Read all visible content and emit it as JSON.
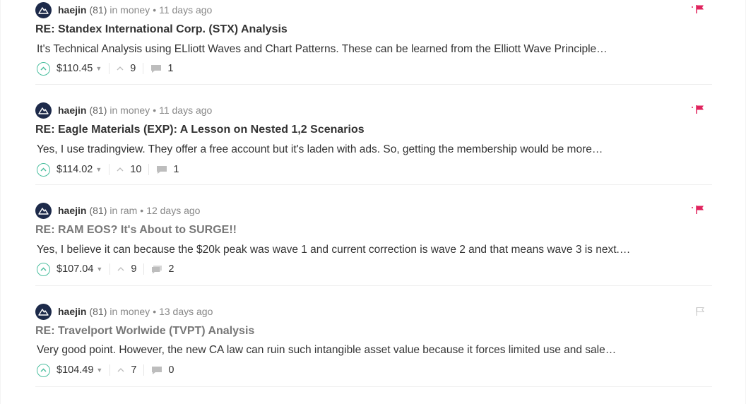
{
  "posts": [
    {
      "author": "haejin",
      "reputation": "(81)",
      "community_prefix": "in money",
      "separator": "•",
      "age": "11 days ago",
      "title": "RE: Standex International Corp. (STX) Analysis",
      "title_style": "dark",
      "body": "It's Technical Analysis using ELliott Waves and Chart Patterns. These can be learned from the Elliott Wave Principle…",
      "payout": "$110.45",
      "votes": "9",
      "replies": "1",
      "flagged": true
    },
    {
      "author": "haejin",
      "reputation": "(81)",
      "community_prefix": "in money",
      "separator": "•",
      "age": "11 days ago",
      "title": "RE: Eagle Materials (EXP): A Lesson on Nested 1,2 Scenarios",
      "title_style": "dark",
      "body": "Yes, I use tradingview. They offer a free account but it's laden with ads. So, getting the membership would be more…",
      "payout": "$114.02",
      "votes": "10",
      "replies": "1",
      "flagged": true
    },
    {
      "author": "haejin",
      "reputation": "(81)",
      "community_prefix": "in ram",
      "separator": "•",
      "age": "12 days ago",
      "title": "RE: RAM EOS? It's About to SURGE!!",
      "title_style": "muted",
      "body": "Yes, I believe it can because the $20k peak was wave 1 and current correction is wave 2 and that means wave 3 is next.…",
      "payout": "$107.04",
      "votes": "9",
      "replies": "2",
      "flagged": true
    },
    {
      "author": "haejin",
      "reputation": "(81)",
      "community_prefix": "in money",
      "separator": "•",
      "age": "13 days ago",
      "title": "RE: Travelport Worlwide (TVPT) Analysis",
      "title_style": "muted",
      "body": "Very good point. However, the new CA law can ruin such intangible asset value because it forces limited use and sale…",
      "payout": "$104.49",
      "votes": "7",
      "replies": "0",
      "flagged": false
    }
  ],
  "colors": {
    "accent": "#4bbf9f",
    "flag": "#e0245e",
    "avatar": "#1d2a4a"
  }
}
